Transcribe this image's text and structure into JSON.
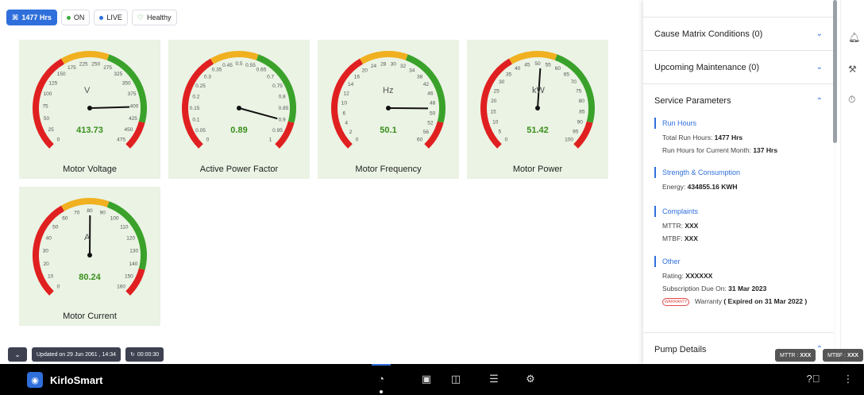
{
  "status": {
    "hours": "1477 Hrs",
    "on": "ON",
    "live": "LIVE",
    "healthy": "Healthy",
    "colors": {
      "on": "#3cb043",
      "live": "#2f6fdb",
      "healthy": "#3cb043",
      "hours_bg": "#2f6fdb"
    }
  },
  "gauges": [
    {
      "title": "Motor Voltage",
      "unit": "V",
      "value": "413.73",
      "value_num": 413.73,
      "min": 0,
      "max": 500,
      "ticks": [
        "0",
        "25",
        "50",
        "75",
        "100",
        "125",
        "150",
        "175",
        "225",
        "250",
        "275",
        "325",
        "350",
        "375",
        "400",
        "425",
        "450",
        "475"
      ]
    },
    {
      "title": "Active Power Factor",
      "unit": "",
      "value": "0.89",
      "value_num": 0.89,
      "min": 0,
      "max": 1,
      "ticks": [
        "0",
        "0.05",
        "0.1",
        "0.15",
        "0.2",
        "0.25",
        "0.3",
        "0.35",
        "0.45",
        "0.5",
        "0.55",
        "0.65",
        "0.7",
        "0.75",
        "0.8",
        "0.85",
        "0.9",
        "0.95",
        "1"
      ]
    },
    {
      "title": "Motor Frequency",
      "unit": "Hz",
      "value": "50.1",
      "value_num": 50.1,
      "min": 0,
      "max": 60,
      "ticks": [
        "0",
        "2",
        "4",
        "6",
        "10",
        "12",
        "14",
        "16",
        "20",
        "24",
        "28",
        "30",
        "32",
        "34",
        "38",
        "42",
        "46",
        "48",
        "50",
        "52",
        "56",
        "60"
      ]
    },
    {
      "title": "Motor Power",
      "unit": "kW",
      "value": "51.42",
      "value_num": 51.42,
      "min": 0,
      "max": 100,
      "ticks": [
        "0",
        "5",
        "10",
        "15",
        "20",
        "25",
        "30",
        "35",
        "40",
        "45",
        "50",
        "55",
        "60",
        "65",
        "70",
        "75",
        "80",
        "85",
        "90",
        "95",
        "100"
      ]
    },
    {
      "title": "Motor Current",
      "unit": "A",
      "value": "80.24",
      "value_num": 80.24,
      "min": 0,
      "max": 160,
      "ticks": [
        "0",
        "10",
        "20",
        "30",
        "40",
        "50",
        "60",
        "70",
        "80",
        "90",
        "100",
        "110",
        "120",
        "130",
        "140",
        "150",
        "160"
      ]
    }
  ],
  "panel": {
    "top_accordions": [
      {
        "label": "Cause Matrix Conditions (0)",
        "chevron": "chevron-down-icon"
      },
      {
        "label": "Upcoming Maintenance (0)",
        "chevron": "chevron-down-icon"
      },
      {
        "label": "Service Parameters",
        "chevron": "chevron-up-icon"
      }
    ],
    "sections": [
      {
        "title": "Run Hours",
        "lines": [
          {
            "k": "Total Run Hours: ",
            "v": "1477 Hrs"
          },
          {
            "k": "Run Hours for Current Month: ",
            "v": "137 Hrs"
          }
        ]
      },
      {
        "title": "Strength & Consumption",
        "lines": [
          {
            "k": "Energy: ",
            "v": "434855.16 KWH"
          }
        ]
      },
      {
        "title": "Complaints",
        "lines": [
          {
            "k": "MTTR: ",
            "v": "XXX"
          },
          {
            "k": "MTBF: ",
            "v": "XXX"
          }
        ]
      },
      {
        "title": "Other",
        "lines": [
          {
            "k": "Rating: ",
            "v": "XXXXXX"
          },
          {
            "k": "Subscription Due On: ",
            "v": "31 Mar 2023"
          }
        ]
      }
    ],
    "warranty": {
      "badge": "WARRANTY",
      "label": "Warranty",
      "status": "( Expired on 31 Mar 2022 )"
    },
    "bottom_accordion": "Pump Details"
  },
  "metrics": {
    "mttr_label": "MTTR : ",
    "mttr": "XXX",
    "mtbf_label": "MTBF : ",
    "mtbf": "XXX"
  },
  "toolbar": {
    "updated": "Updated on 29 Jun 2061 , 14:34",
    "timer": "00:00:30"
  },
  "taskbar": {
    "brand": "KirloSmart",
    "icons": [
      "speedometer-icon",
      "image-icon",
      "chart-icon",
      "list-icon",
      "settings-icon"
    ],
    "right_icons": [
      "help-icon",
      "more-icon"
    ]
  },
  "gauge_colors": {
    "red": "#e02020",
    "yellow": "#f0b020",
    "green": "#3aa22a",
    "card": "#eaf3e4"
  }
}
